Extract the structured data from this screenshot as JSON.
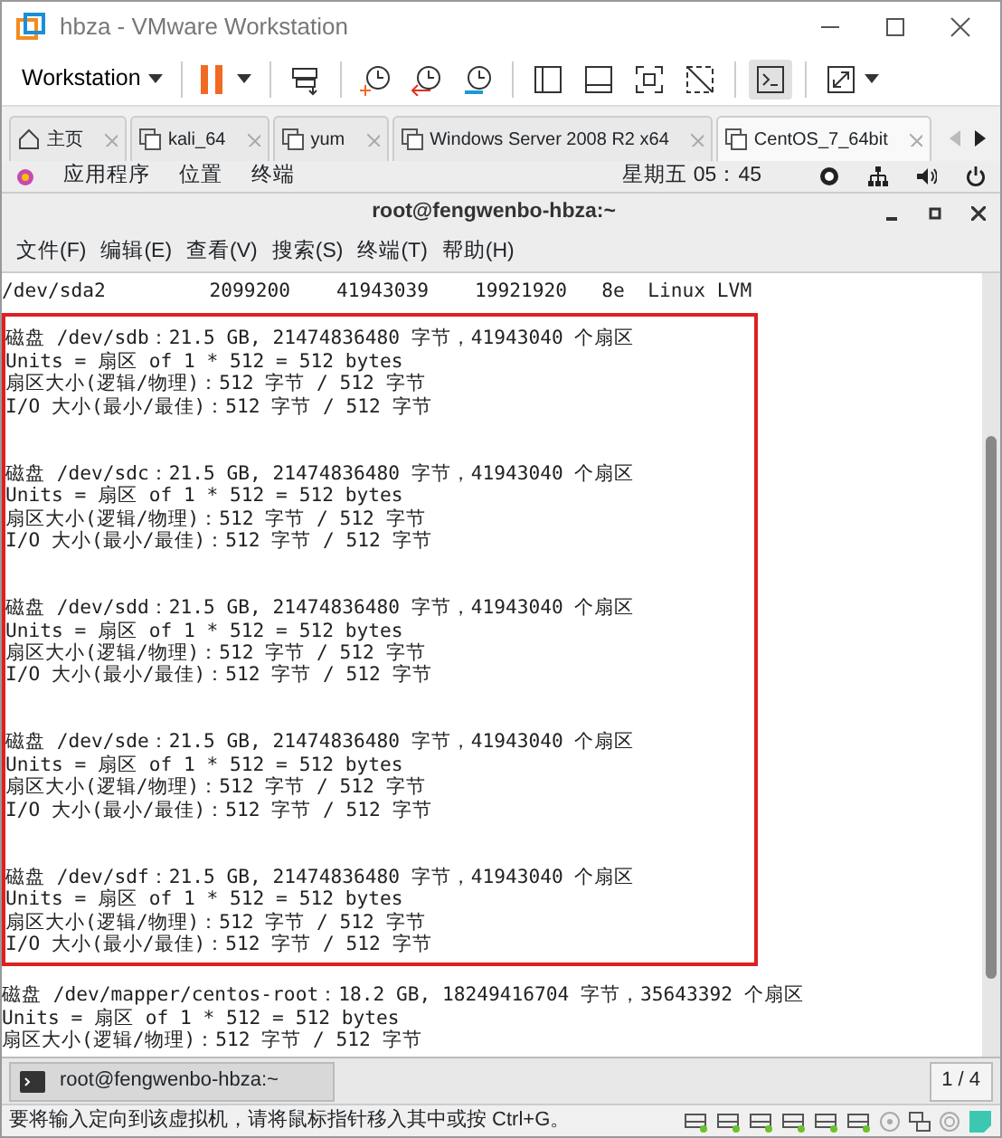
{
  "window": {
    "title": "hbza - VMware Workstation"
  },
  "toolbar": {
    "menu_label": "Workstation",
    "console_view_on": true
  },
  "tabs": [
    {
      "label": "主页",
      "kind": "home",
      "selected": false
    },
    {
      "label": "kali_64",
      "kind": "vm",
      "selected": false
    },
    {
      "label": "yum",
      "kind": "vm",
      "selected": false
    },
    {
      "label": "Windows Server 2008 R2 x64",
      "kind": "vm",
      "selected": false
    },
    {
      "label": "CentOS_7_64bit",
      "kind": "vm",
      "selected": true
    }
  ],
  "guest_top_bar": {
    "menus": [
      "应用程序",
      "位置",
      "终端"
    ],
    "clock": "星期五 05：45"
  },
  "terminal": {
    "title": "root@fengwenbo-hbza:~",
    "menus": [
      "文件(F)",
      "编辑(E)",
      "查看(V)",
      "搜索(S)",
      "终端(T)",
      "帮助(H)"
    ],
    "partition_line": "/dev/sda2         2099200    41943039    19921920   8e  Linux LVM",
    "disks": [
      {
        "highlighted": true,
        "lines": [
          "磁盘 /dev/sdb：21.5 GB, 21474836480 字节，41943040 个扇区",
          "Units = 扇区 of 1 * 512 = 512 bytes",
          "扇区大小(逻辑/物理)：512 字节 / 512 字节",
          "I/O 大小(最小/最佳)：512 字节 / 512 字节"
        ]
      },
      {
        "highlighted": true,
        "lines": [
          "磁盘 /dev/sdc：21.5 GB, 21474836480 字节，41943040 个扇区",
          "Units = 扇区 of 1 * 512 = 512 bytes",
          "扇区大小(逻辑/物理)：512 字节 / 512 字节",
          "I/O 大小(最小/最佳)：512 字节 / 512 字节"
        ]
      },
      {
        "highlighted": true,
        "lines": [
          "磁盘 /dev/sdd：21.5 GB, 21474836480 字节，41943040 个扇区",
          "Units = 扇区 of 1 * 512 = 512 bytes",
          "扇区大小(逻辑/物理)：512 字节 / 512 字节",
          "I/O 大小(最小/最佳)：512 字节 / 512 字节"
        ]
      },
      {
        "highlighted": true,
        "lines": [
          "磁盘 /dev/sde：21.5 GB, 21474836480 字节，41943040 个扇区",
          "Units = 扇区 of 1 * 512 = 512 bytes",
          "扇区大小(逻辑/物理)：512 字节 / 512 字节",
          "I/O 大小(最小/最佳)：512 字节 / 512 字节"
        ]
      },
      {
        "highlighted": true,
        "lines": [
          "磁盘 /dev/sdf：21.5 GB, 21474836480 字节，41943040 个扇区",
          "Units = 扇区 of 1 * 512 = 512 bytes",
          "扇区大小(逻辑/物理)：512 字节 / 512 字节",
          "I/O 大小(最小/最佳)：512 字节 / 512 字节"
        ]
      },
      {
        "highlighted": false,
        "lines": [
          "磁盘 /dev/mapper/centos-root：18.2 GB, 18249416704 字节，35643392 个扇区",
          "Units = 扇区 of 1 * 512 = 512 bytes",
          "扇区大小(逻辑/物理)：512 字节 / 512 字节"
        ]
      }
    ]
  },
  "taskbar": {
    "window_label": "root@fengwenbo-hbza:~",
    "workspace": "1 / 4"
  },
  "status_bar": {
    "message": "要将输入定向到该虚拟机，请将鼠标指针移入其中或按 Ctrl+G。",
    "disks_connected": [
      true,
      true,
      true,
      true,
      true,
      true
    ]
  }
}
